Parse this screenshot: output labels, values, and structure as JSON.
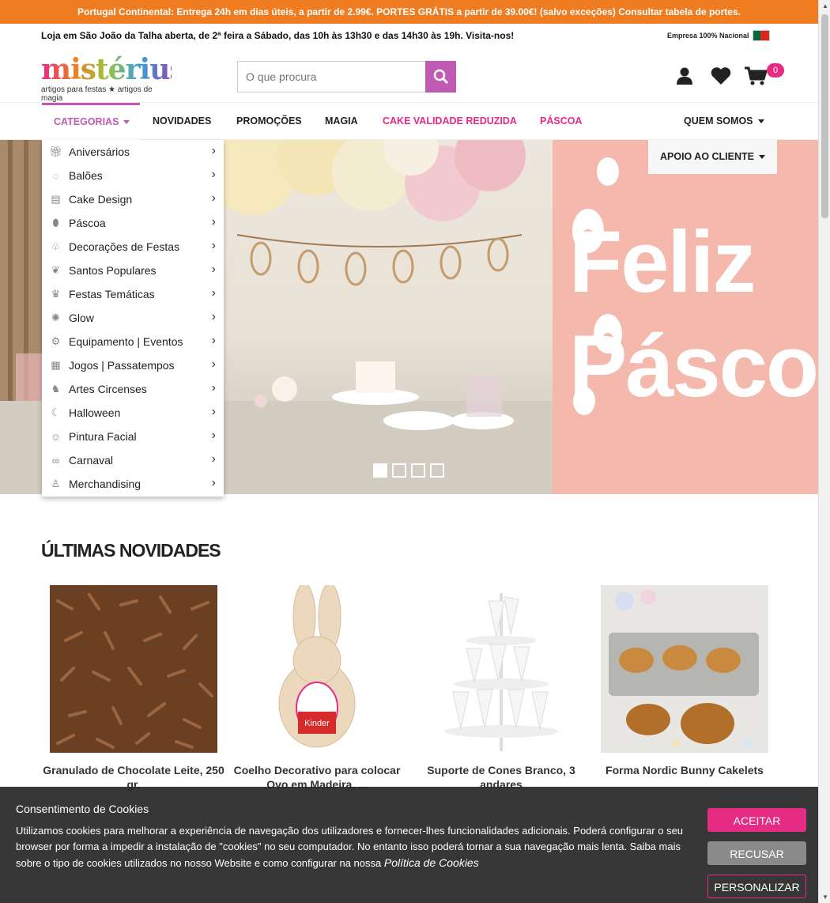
{
  "promo_bar": {
    "text": "Portugal Continental: Entrega 24h em dias úteis, a partir de 2.99€. PORTES GRÁTIS a partir de 39.00€! (salvo exceções) Consultar tabela de portes."
  },
  "info_bar": {
    "text": "Loja em São João da Talha aberta, de 2ª feira a Sábado, das 10h às 13h30 e das 14h30 às 19h. Visita-nos!",
    "national": "Empresa 100% Nacional"
  },
  "logo": {
    "name": "mistérius",
    "tagline": "artigos para festas ★ artigos de magia"
  },
  "search": {
    "placeholder": "O que procura"
  },
  "header": {
    "cart_count": "0"
  },
  "nav": {
    "categories": "CATEGORIAS",
    "items": [
      "NOVIDADES",
      "PROMOÇÕES",
      "MAGIA",
      "CAKE VALIDADE REDUZIDA",
      "PÁSCOA"
    ],
    "quem_somos": "QUEM SOMOS",
    "apoio": "APOIO AO CLIENTE"
  },
  "category_menu": [
    {
      "label": "Aniversários",
      "icon": "gift-icon"
    },
    {
      "label": "Balões",
      "icon": "balloons-icon"
    },
    {
      "label": "Cake Design",
      "icon": "cake-icon"
    },
    {
      "label": "Páscoa",
      "icon": "egg-icon"
    },
    {
      "label": "Decorações de Festas",
      "icon": "decoration-icon"
    },
    {
      "label": "Santos Populares",
      "icon": "sardine-icon"
    },
    {
      "label": "Festas Temáticas",
      "icon": "crown-icon"
    },
    {
      "label": "Glow",
      "icon": "glow-icon"
    },
    {
      "label": "Equipamento | Eventos",
      "icon": "equipment-icon"
    },
    {
      "label": "Jogos | Passatempos",
      "icon": "games-icon"
    },
    {
      "label": "Artes Circenses",
      "icon": "circus-icon"
    },
    {
      "label": "Halloween",
      "icon": "halloween-icon"
    },
    {
      "label": "Pintura Facial",
      "icon": "face-paint-icon"
    },
    {
      "label": "Carnaval",
      "icon": "mask-icon"
    },
    {
      "label": "Merchandising",
      "icon": "tshirt-icon"
    }
  ],
  "hero": {
    "line1": "Feliz",
    "line2": "Pásco"
  },
  "section": {
    "title": "ÚLTIMAS NOVIDADES"
  },
  "products": [
    {
      "name": "Granulado de Chocolate Leite, 250 gr."
    },
    {
      "name": "Coelho Decorativo para colocar Ovo em Madeira, ..."
    },
    {
      "name": "Suporte de Cones Branco, 3 andares"
    },
    {
      "name": "Forma Nordic Bunny Cakelets"
    }
  ],
  "cookie": {
    "title": "Consentimento de Cookies",
    "body": "Utilizamos cookies para melhorar a experiência de navegação dos utilizadores e fornecer-lhes funcionalidades adicionais. Poderá configurar o seu browser por forma a impedir a instalação de \"cookies\" no seu computador. No entanto isso poderá tornar a sua navegação mais lenta. Saiba mais sobre o tipo de cookies utilizados no nosso Website e como configurar na nossa",
    "link": "Política de Cookies",
    "accept": "ACEITAR",
    "reject": "RECUSAR",
    "customize": "PERSONALIZAR"
  },
  "colors": {
    "accent": "#c15ab3",
    "pink": "#e52b84",
    "orange": "#f07c22"
  }
}
